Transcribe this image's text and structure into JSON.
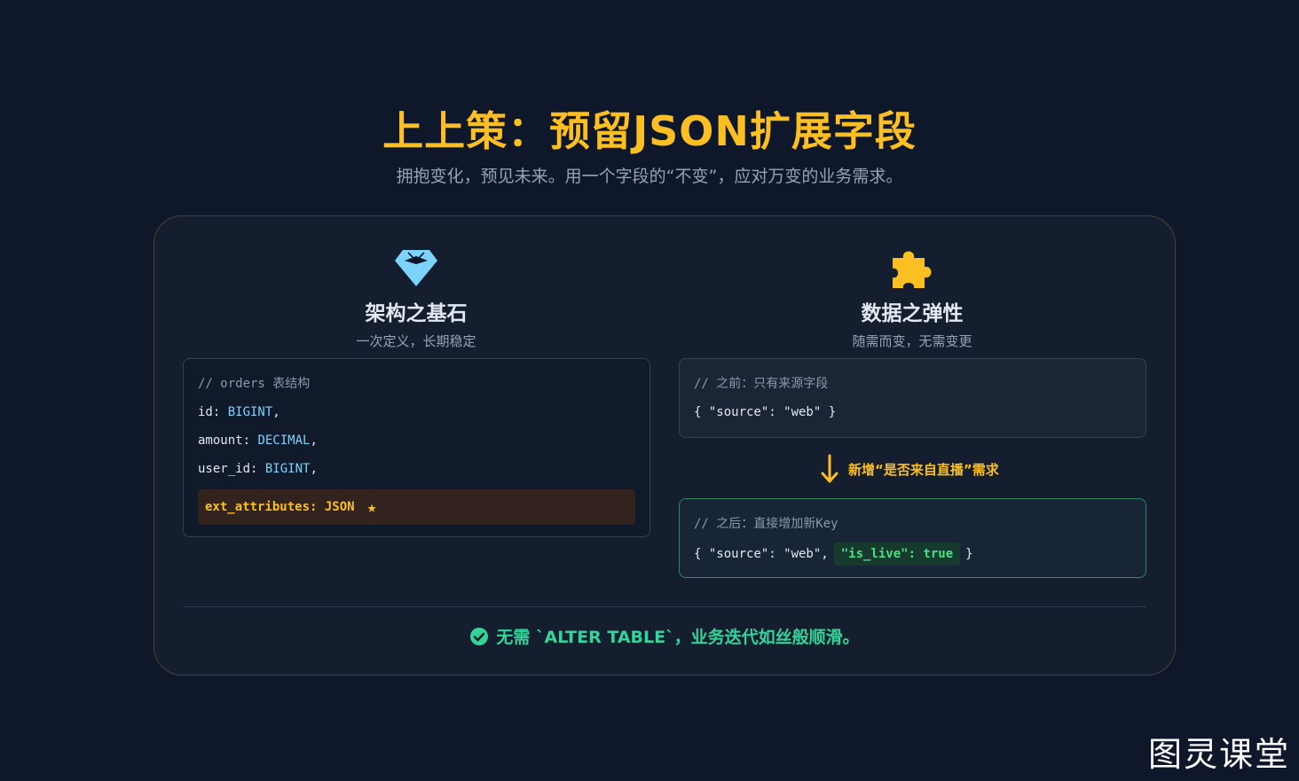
{
  "header": {
    "title": "上上策：预留JSON扩展字段",
    "subtitle": "拥抱变化，预见未来。用一个字段的“不变”，应对万变的业务需求。"
  },
  "left": {
    "icon": "diamond-icon",
    "title": "架构之基石",
    "desc": "一次定义，长期稳定",
    "code": {
      "comment": "// orders 表结构",
      "fields": [
        {
          "name": "id",
          "type": "BIGINT"
        },
        {
          "name": "amount",
          "type": "DECIMAL"
        },
        {
          "name": "user_id",
          "type": "BIGINT"
        }
      ],
      "highlight": "ext_attributes: JSON",
      "highlight_icon": "star-icon"
    }
  },
  "right": {
    "icon": "puzzle-icon",
    "title": "数据之弹性",
    "desc": "随需而变，无需变更",
    "before": {
      "comment": "// 之前：只有来源字段",
      "json": "{ \"source\": \"web\" }"
    },
    "transition": {
      "icon": "arrow-down-icon",
      "label": "新增“是否来自直播”需求"
    },
    "after": {
      "comment": "// 之后：直接增加新Key",
      "prefix": "{ \"source\": \"web\",",
      "new_key": "\"is_live\": true",
      "suffix": "}"
    }
  },
  "footer": {
    "icon": "check-circle-icon",
    "text": "无需 `ALTER TABLE`，业务迭代如丝般顺滑。"
  },
  "watermark": "图灵课堂",
  "colors": {
    "accent": "#fbbf24",
    "success": "#34d399",
    "type_blue": "#7dd3fc",
    "background": "#0f172a"
  }
}
